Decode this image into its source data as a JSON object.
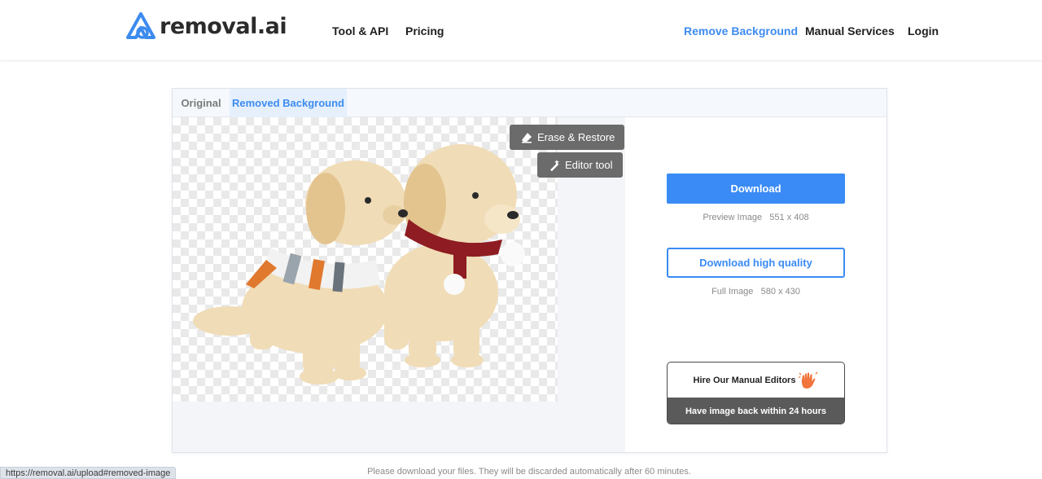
{
  "nav": {
    "logo_text": "removal.ai",
    "links": [
      "Tool & API",
      "Pricing",
      "Remove Background",
      "Manual Services",
      "Login"
    ],
    "active_link": "Remove Background"
  },
  "tabs": [
    "Original",
    "Removed Background"
  ],
  "selected_tab": "Removed Background",
  "tools": {
    "erase_restore": "Erase & Restore",
    "editor_tool": "Editor tool"
  },
  "download": {
    "button": "Download",
    "preview_label": "Preview Image",
    "preview_size": "551 x 408",
    "hq_button": "Download high quality",
    "full_label": "Full Image",
    "full_size": "580 x 430"
  },
  "hire": {
    "title": "Hire Our Manual Editors",
    "subtitle": "Have image back within 24 hours",
    "icon": "hand-wave-icon"
  },
  "footer_notice": "Please download your files. They will be discarded automatically after 60 minutes.",
  "status_url": "https://removal.ai/upload#removed-image",
  "colors": {
    "accent": "#3a8bf5",
    "tool_button": "#6b6b6b",
    "hire_bottom": "#5a5a5a",
    "hand_icon": "#f0743c"
  }
}
